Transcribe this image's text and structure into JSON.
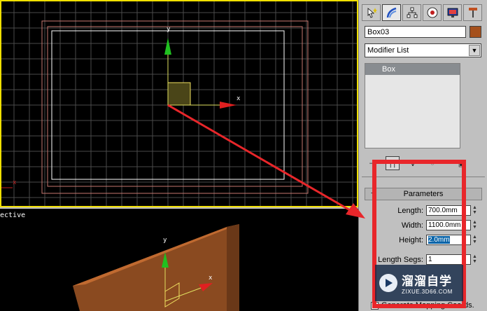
{
  "viewport_top": {
    "axis_y": "y",
    "axis_x": "x",
    "corner_axis_x": "x"
  },
  "viewport_perspective": {
    "label": "ective",
    "axis_y": "y",
    "axis_x": "x"
  },
  "command_panel": {
    "tabs": [
      "create-tab",
      "modify-tab",
      "hierarchy-tab",
      "motion-tab",
      "display-tab",
      "utilities-tab"
    ],
    "object_name": "Box03",
    "object_color": "#a5501c",
    "modifier_list": "Modifier List",
    "stack_item": "Box",
    "parameters_title": "Parameters",
    "collapse": "−",
    "length_label": "Length:",
    "length_value": "700.0mm",
    "width_label": "Width:",
    "width_value": "1100.0mm",
    "height_label": "Height:",
    "height_value": "2.0mm",
    "length_segs_label": "Length Segs:",
    "length_segs_value": "1",
    "generate_mapping": "Generate Mapping Coords.",
    "generate_mapping_checked": true
  },
  "watermark": {
    "title": "溜溜自学",
    "url": "ZIXUE.3D66.COM"
  },
  "colors": {
    "annotation_red": "#e8262a",
    "active_viewport_border": "#f0e000",
    "grid": "#4a4a4a"
  }
}
